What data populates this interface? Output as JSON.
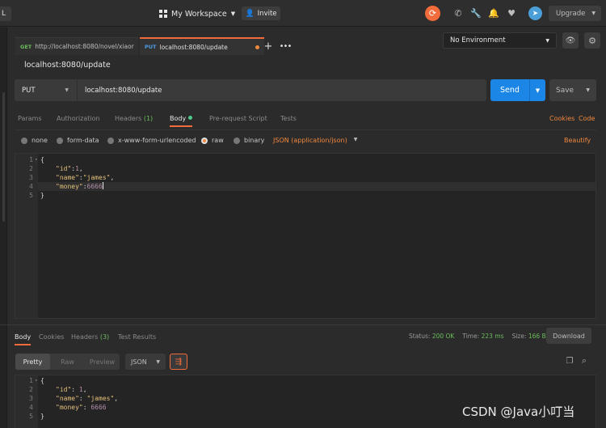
{
  "topbar": {
    "left_stub": "L",
    "workspace_label": "My Workspace",
    "invite_label": "Invite",
    "upgrade_label": "Upgrade"
  },
  "tabs": [
    {
      "method": "GET",
      "label": "http://localhost:8080/novel/xiaor"
    },
    {
      "method": "PUT",
      "label": "localhost:8080/update"
    }
  ],
  "environment": {
    "selected": "No Environment"
  },
  "request": {
    "title": "localhost:8080/update",
    "method": "PUT",
    "url": "localhost:8080/update",
    "send_label": "Send",
    "save_label": "Save"
  },
  "request_tabs": {
    "params": "Params",
    "authorization": "Authorization",
    "headers": "Headers",
    "headers_count": "(1)",
    "body": "Body",
    "prerequest": "Pre-request Script",
    "tests": "Tests",
    "cookies": "Cookies",
    "code": "Code"
  },
  "body_types": {
    "none": "none",
    "form_data": "form-data",
    "urlencoded": "x-www-form-urlencoded",
    "raw": "raw",
    "binary": "binary",
    "json": "JSON (application/json)",
    "beautify": "Beautify"
  },
  "request_body": {
    "lines": [
      {
        "num": "1",
        "text": "{"
      },
      {
        "num": "2",
        "key": "\"id\"",
        "sep": ":",
        "val": "1",
        "tail": ","
      },
      {
        "num": "3",
        "key": "\"name\"",
        "sep": ":",
        "val": "\"james\"",
        "tail": ","
      },
      {
        "num": "4",
        "key": "\"money\"",
        "sep": ":",
        "val": "6666",
        "tail": ""
      },
      {
        "num": "5",
        "text": "}"
      }
    ]
  },
  "response_tabs": {
    "body": "Body",
    "cookies": "Cookies",
    "headers": "Headers",
    "headers_count": "(3)",
    "test_results": "Test Results"
  },
  "response_status": {
    "status_label": "Status:",
    "status_value": "200 OK",
    "time_label": "Time:",
    "time_value": "223 ms",
    "size_label": "Size:",
    "size_value": "166 B",
    "download_label": "Download"
  },
  "response_view": {
    "pretty": "Pretty",
    "raw": "Raw",
    "preview": "Preview",
    "format": "JSON"
  },
  "response_body": {
    "lines": [
      {
        "num": "1",
        "text": "{"
      },
      {
        "num": "2",
        "key": "\"id\"",
        "sep": ": ",
        "val": "1",
        "tail": ","
      },
      {
        "num": "3",
        "key": "\"name\"",
        "sep": ": ",
        "val": "\"james\"",
        "tail": ","
      },
      {
        "num": "4",
        "key": "\"money\"",
        "sep": ": ",
        "val": "6666",
        "tail": ""
      },
      {
        "num": "5",
        "text": "}"
      }
    ]
  },
  "watermark": "CSDN @Java小叮当",
  "colors": {
    "accent": "#f26b3a",
    "send": "#1b86e6",
    "get": "#6bbd5b",
    "put": "#4c9ee6",
    "status_ok": "#6bbd5b"
  }
}
